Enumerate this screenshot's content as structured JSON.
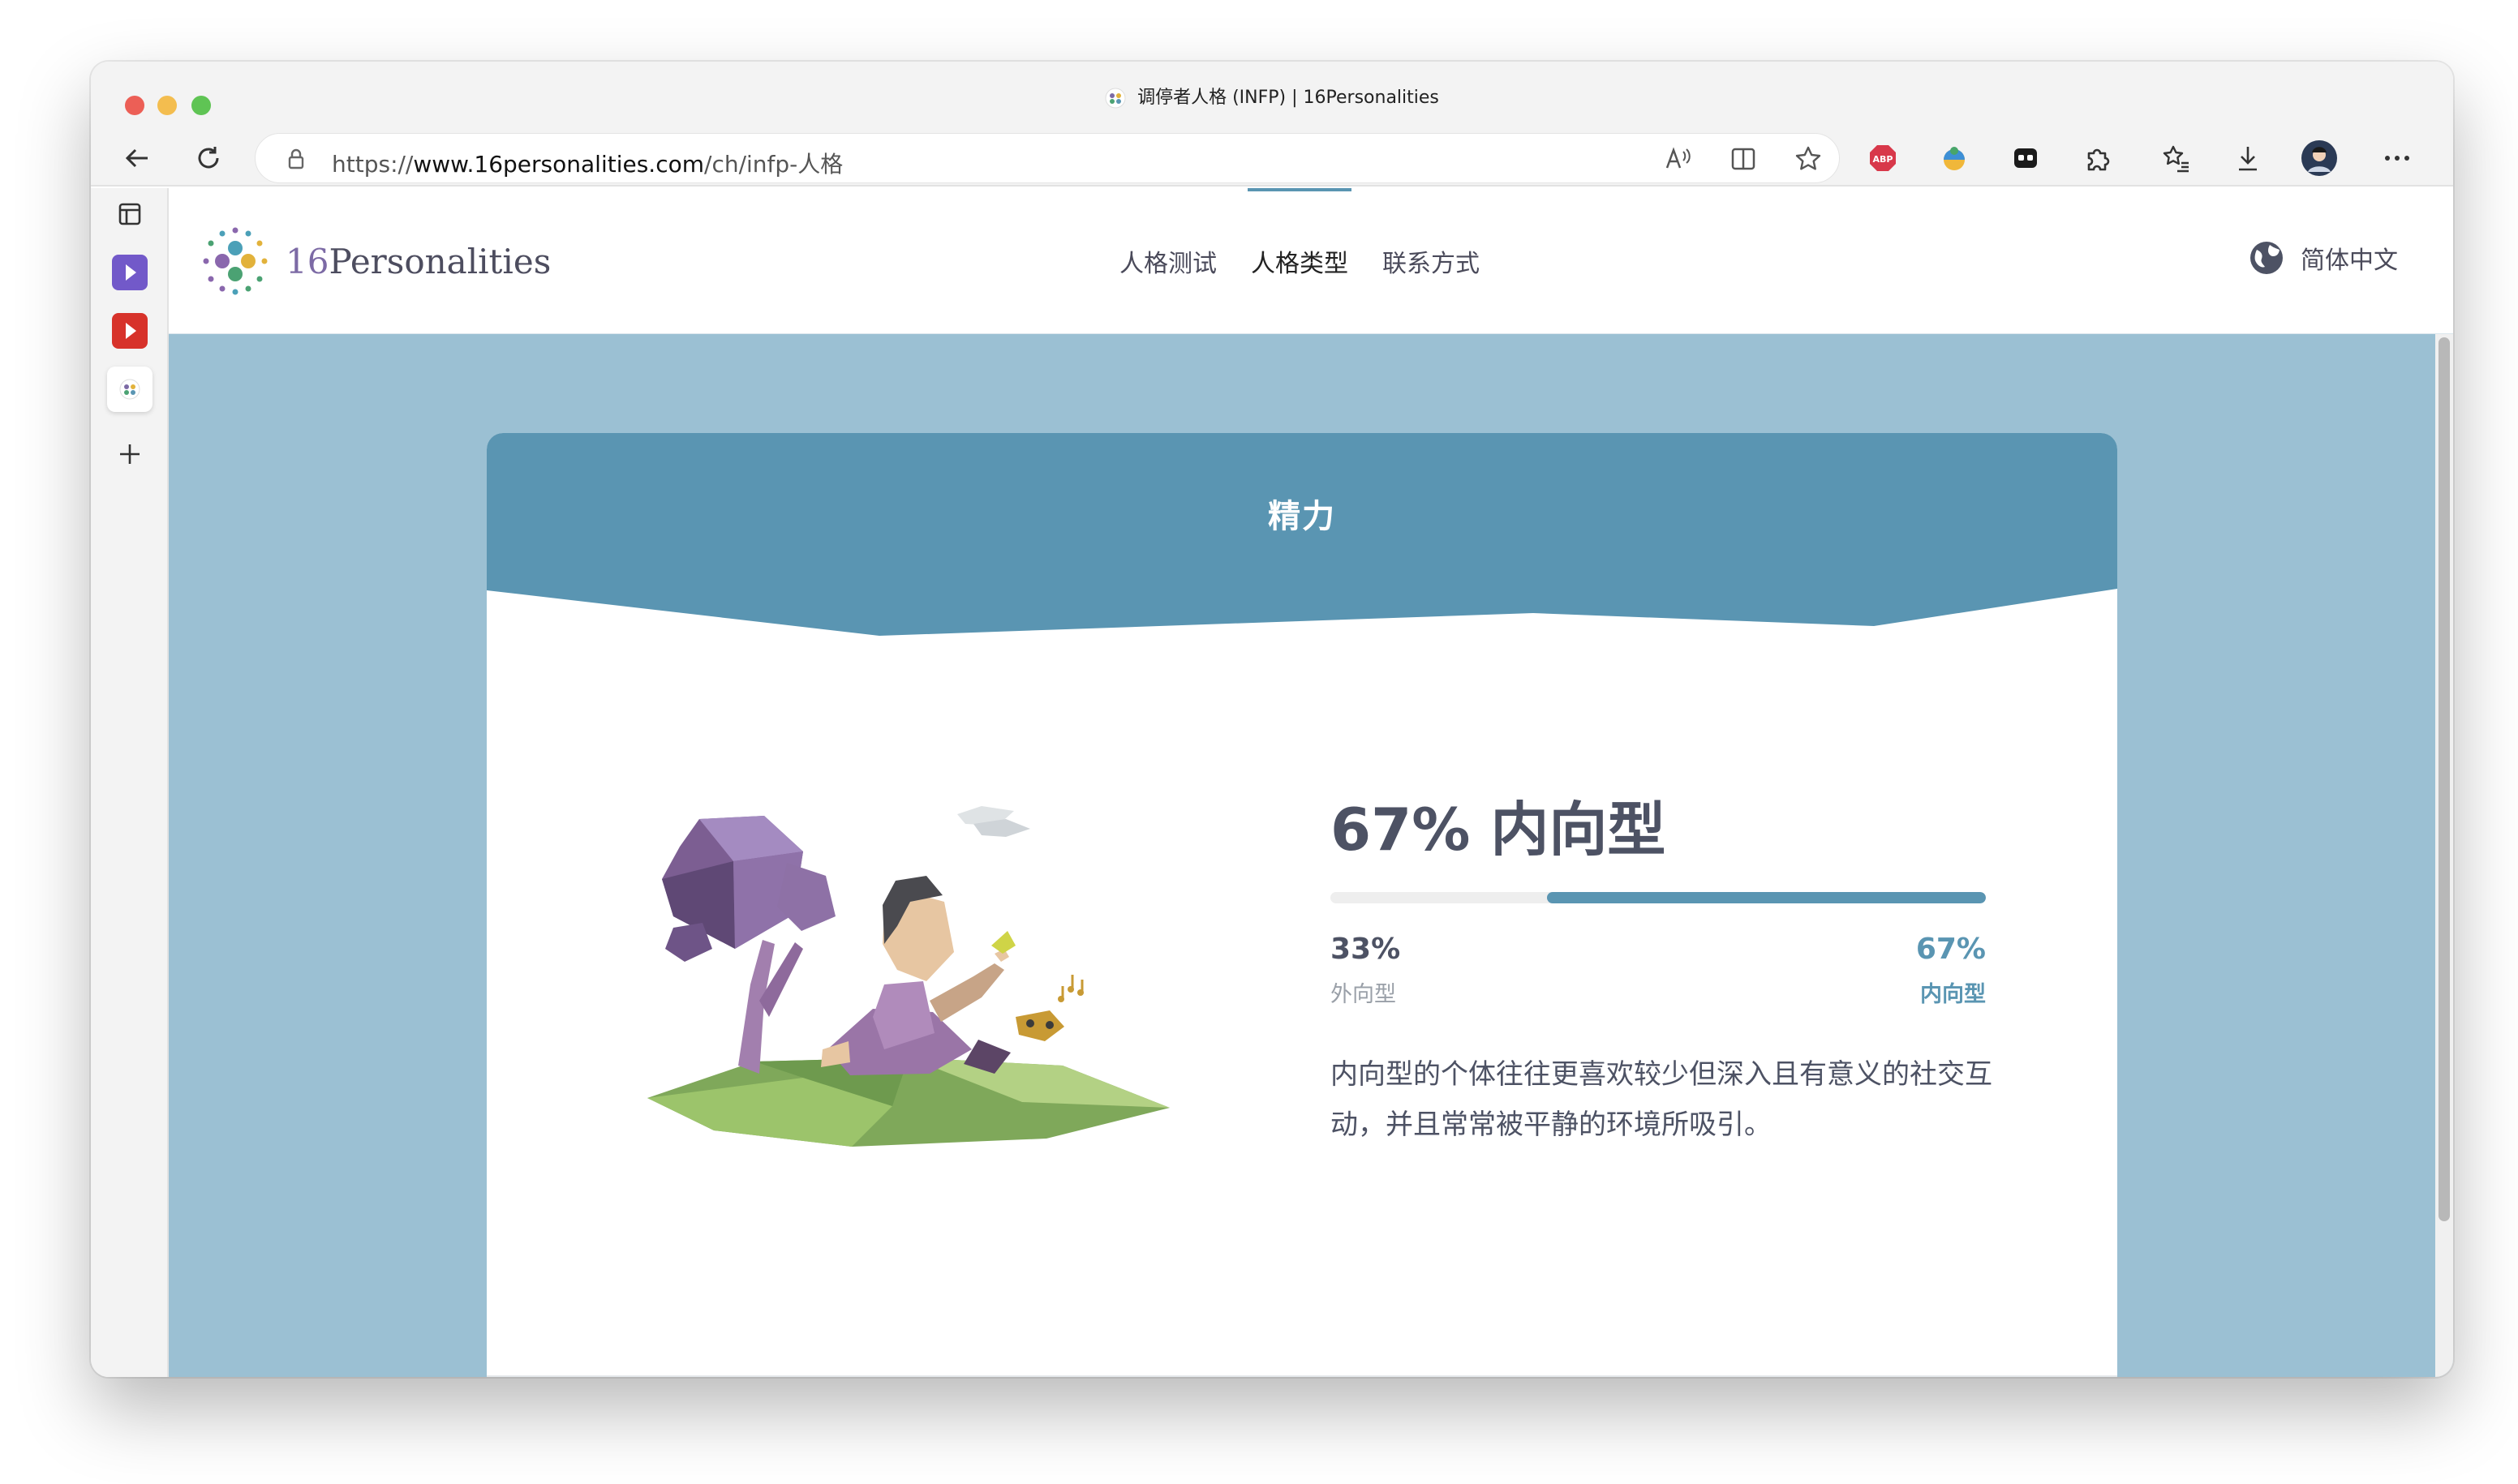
{
  "browser": {
    "tab_title": "调停者人格 (INFP) | 16Personalities",
    "url_prefix": "https://",
    "url_host": "www.16personalities.com",
    "url_path": "/ch/infp-人格"
  },
  "site": {
    "logo_number": "16",
    "logo_word": "Personalities",
    "nav": [
      "人格测试",
      "人格类型",
      "联系方式"
    ],
    "active_nav": "人格类型",
    "language": "简体中文"
  },
  "card": {
    "title": "精力",
    "heading": "67% 内向型",
    "left_percent": "33%",
    "left_label": "外向型",
    "right_percent": "67%",
    "right_label": "内向型",
    "right_fraction": 0.67,
    "description": "内向型的个体往往更喜欢较少但深入且有意义的社交互动，并且常常被平静的环境所吸引。"
  },
  "colors": {
    "accent": "#5a95b2",
    "page_background": "#9bc0d3",
    "heading_text": "#4d5264"
  },
  "icons": [
    "back-arrow-icon",
    "reload-icon",
    "lock-icon",
    "read-aloud-icon",
    "split-screen-icon",
    "favorite-star-icon",
    "adblock-icon",
    "extension-icon",
    "puzzle-icon",
    "favorites-icon",
    "download-icon",
    "profile-avatar",
    "more-icon",
    "globe-icon"
  ]
}
